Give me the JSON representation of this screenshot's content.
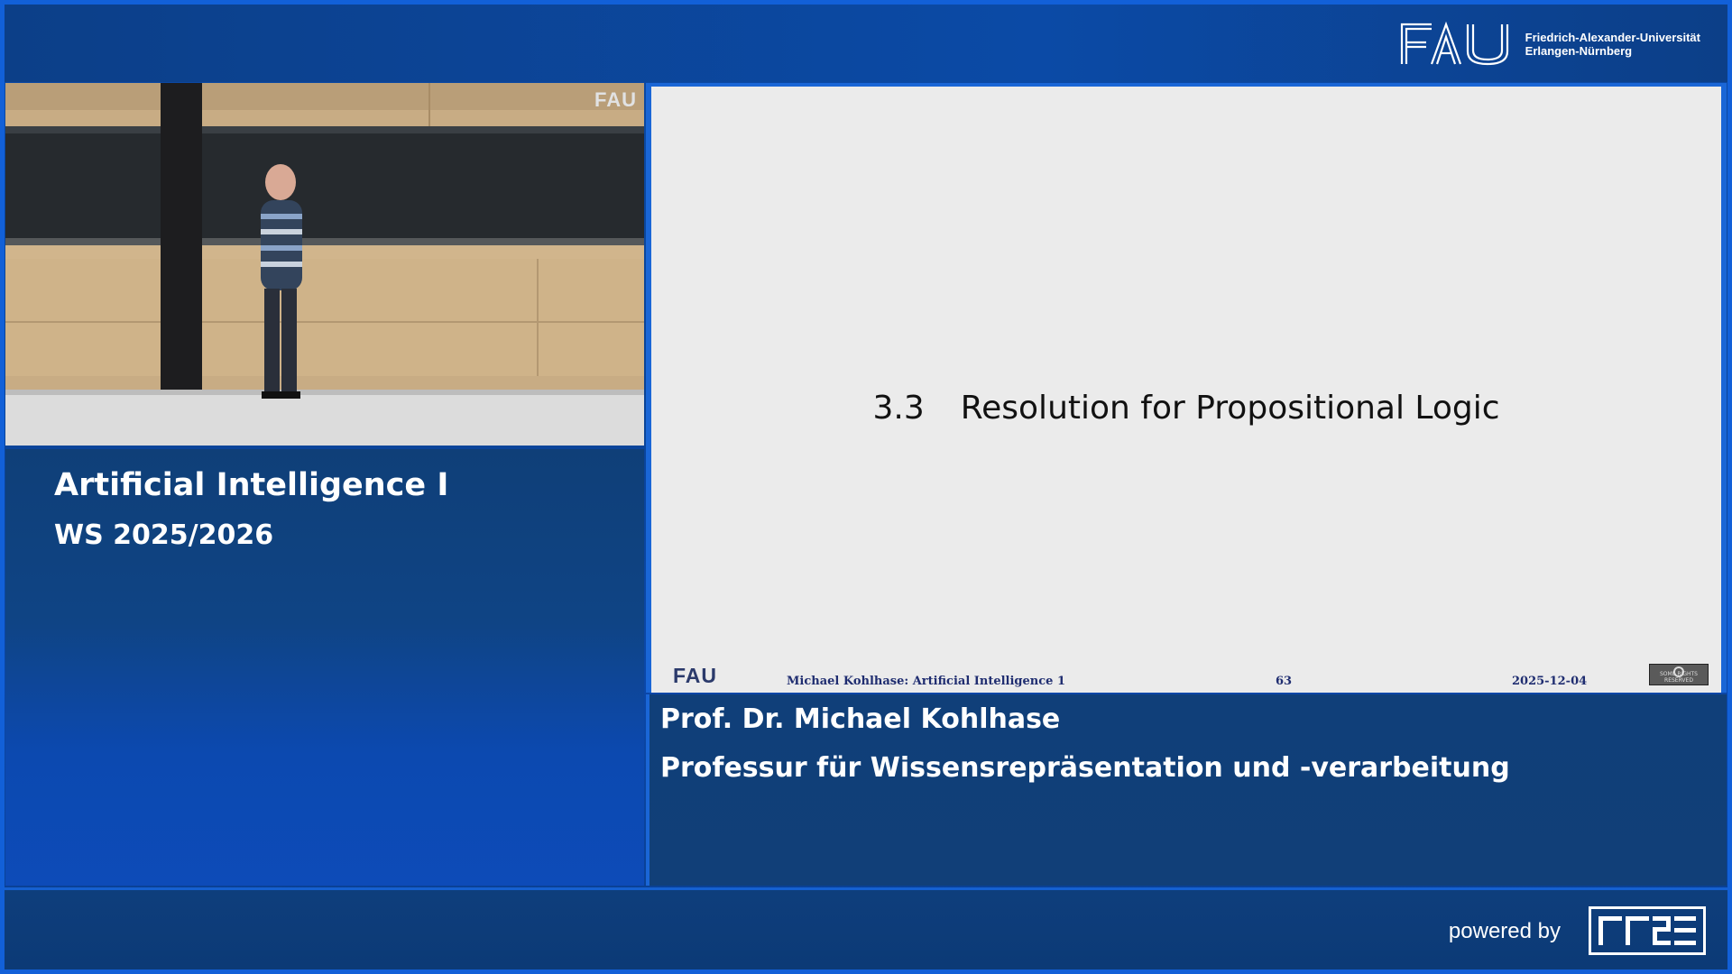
{
  "header": {
    "university_logo_text": "FAU",
    "university_name_line1": "Friedrich-Alexander-Universität",
    "university_name_line2": "Erlangen-Nürnberg"
  },
  "video": {
    "watermark": "FAU"
  },
  "course": {
    "title": "Artificial Intelligence I",
    "term": "WS 2025/2026"
  },
  "slide": {
    "section_number": "3.3",
    "section_title": "Resolution for Propositional Logic",
    "footer": {
      "logo": "FAU",
      "author": "Michael Kohlhase: Artificial Intelligence 1",
      "page": "63",
      "date": "2025-12-04",
      "license_text": "SOME RIGHTS RESERVED"
    }
  },
  "speaker": {
    "name": "Prof. Dr. Michael Kohlhase",
    "chair": "Professur für Wissensrepräsentation und -verarbeitung"
  },
  "footer": {
    "powered_by": "powered by",
    "provider_logo": "RRZE"
  },
  "colors": {
    "frame_border": "#1260d8",
    "panel_blue": "#0f3f78",
    "slide_background": "#ebebeb",
    "slide_footer_text": "#1f2d70"
  }
}
